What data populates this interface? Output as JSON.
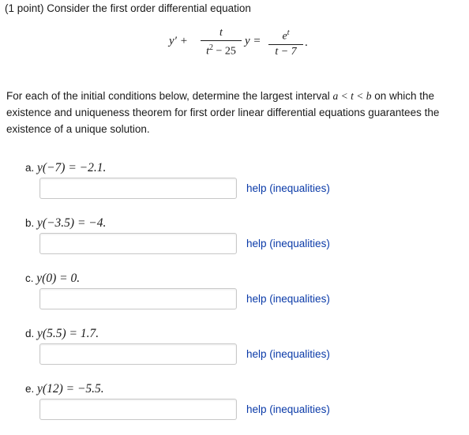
{
  "problem": {
    "intro": "(1 point) Consider the first order differential equation",
    "instructions_before": "For each of the initial conditions below, determine the largest interval ",
    "instructions_math": "a < t < b",
    "instructions_after": " on which the existence and uniqueness theorem for first order linear differential equations guarantees the existence of a unique solution."
  },
  "equation": {
    "lhs": "y′ +",
    "frac1_num": "t",
    "frac1_den_base": "t",
    "frac1_den_exp": "2",
    "frac1_den_rest": " − 25",
    "middle": "y =",
    "frac2_num_base": "e",
    "frac2_num_exp": "t",
    "frac2_den": "t − 7",
    "end": "."
  },
  "items": [
    {
      "letter": "a.",
      "condition": "y(−7) = −2.1.",
      "input_value": "",
      "help": "help (inequalities)"
    },
    {
      "letter": "b.",
      "condition": "y(−3.5) = −4.",
      "input_value": "",
      "help": "help (inequalities)"
    },
    {
      "letter": "c.",
      "condition": "y(0) = 0.",
      "input_value": "",
      "help": "help (inequalities)"
    },
    {
      "letter": "d.",
      "condition": "y(5.5) = 1.7.",
      "input_value": "",
      "help": "help (inequalities)"
    },
    {
      "letter": "e.",
      "condition": "y(12) = −5.5.",
      "input_value": "",
      "help": "help (inequalities)"
    }
  ]
}
